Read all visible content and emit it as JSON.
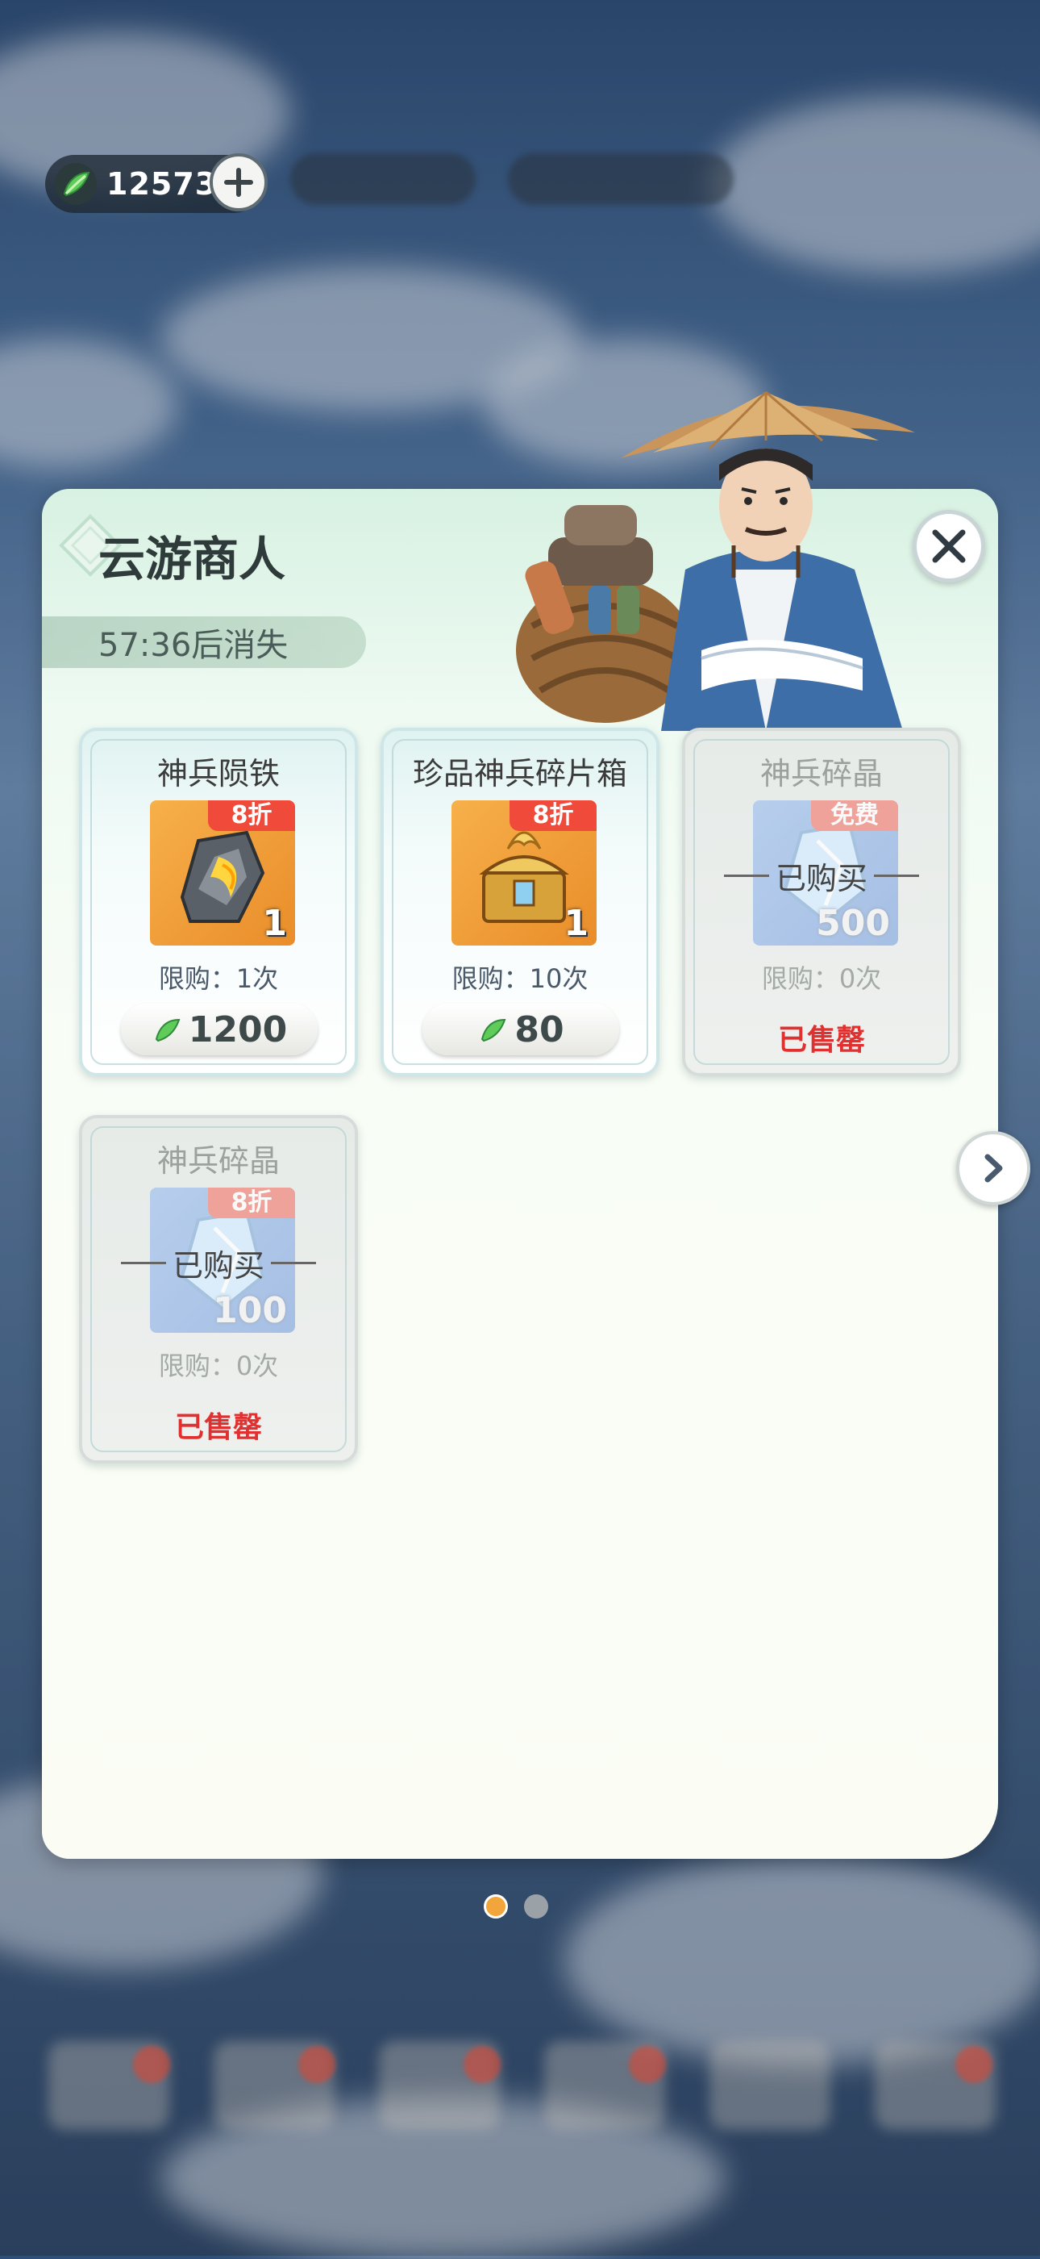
{
  "currency": {
    "amount": "12573",
    "icon": "jade-leaf-icon",
    "plus_icon": "plus-icon"
  },
  "panel": {
    "title": "云游商人",
    "timer": "57:36后消失",
    "close_icon": "close-icon",
    "next_icon": "chevron-right-icon"
  },
  "items": [
    {
      "name": "神兵陨铁",
      "discount": "8折",
      "quantity": "1",
      "limit": "限购：1次",
      "price": "1200",
      "state": "available"
    },
    {
      "name": "珍品神兵碎片箱",
      "discount": "8折",
      "quantity": "1",
      "limit": "限购：10次",
      "price": "80",
      "state": "available"
    },
    {
      "name": "神兵碎晶",
      "discount": "免费",
      "quantity": "500",
      "limit": "限购：0次",
      "bought": "已购买",
      "soldout": "已售罄",
      "state": "sold"
    },
    {
      "name": "神兵碎晶",
      "discount": "8折",
      "quantity": "100",
      "limit": "限购：0次",
      "bought": "已购买",
      "soldout": "已售罄",
      "state": "sold"
    }
  ],
  "pagination": {
    "pages": 2,
    "current": 1
  },
  "colors": {
    "accent": "#f2a53a",
    "discount": "#f04a3a",
    "soldout": "#e03030"
  }
}
